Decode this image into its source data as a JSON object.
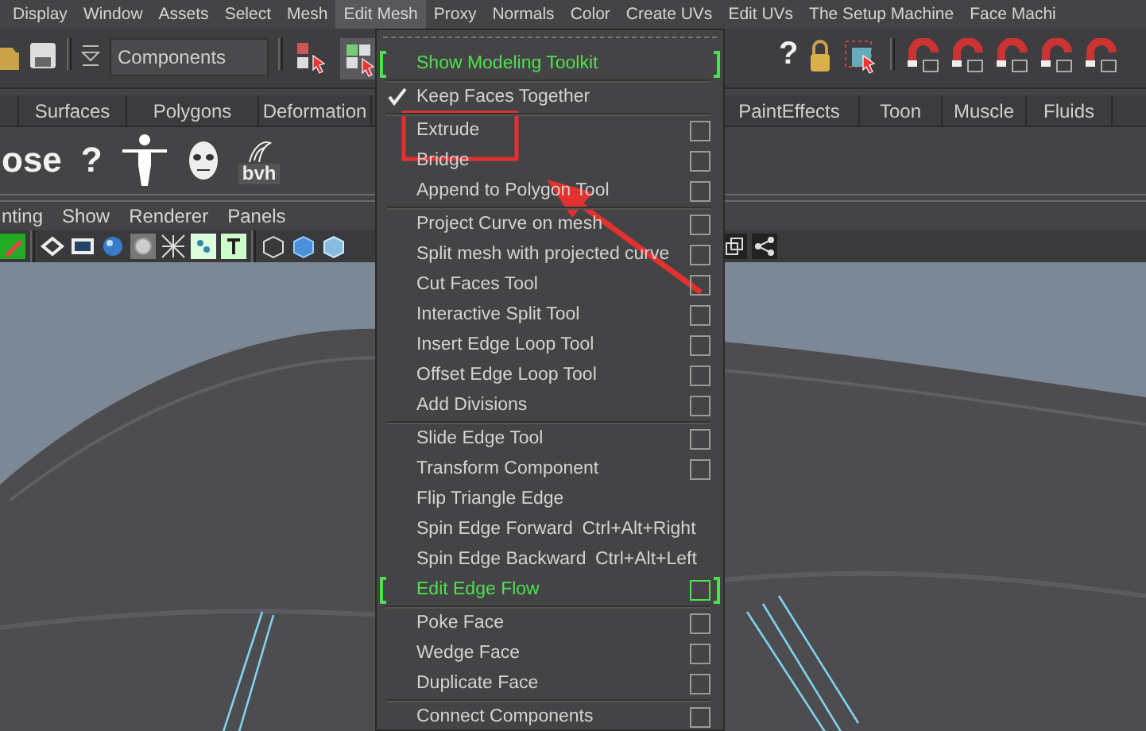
{
  "menubar": [
    {
      "label": "Display",
      "selected": false
    },
    {
      "label": "Window",
      "selected": false
    },
    {
      "label": "Assets",
      "selected": false
    },
    {
      "label": "Select",
      "selected": false
    },
    {
      "label": "Mesh",
      "selected": false
    },
    {
      "label": "Edit Mesh",
      "selected": true
    },
    {
      "label": "Proxy",
      "selected": false
    },
    {
      "label": "Normals",
      "selected": false
    },
    {
      "label": "Color",
      "selected": false
    },
    {
      "label": "Create UVs",
      "selected": false
    },
    {
      "label": "Edit UVs",
      "selected": false
    },
    {
      "label": "The Setup Machine",
      "selected": false
    },
    {
      "label": "Face Machi",
      "selected": false
    }
  ],
  "status_line": {
    "selection_mode": "Components",
    "help": "?"
  },
  "shelf_tabs": [
    "Surfaces",
    "Polygons",
    "Deformation",
    "PaintEffects",
    "Toon",
    "Muscle",
    "Fluids"
  ],
  "shelf": {
    "pose_label": "ose",
    "help": "?",
    "bvh": "bvh"
  },
  "panel_menu": [
    "nting",
    "Show",
    "Renderer",
    "Panels"
  ],
  "dropdown": {
    "items": [
      {
        "kind": "toolkit",
        "label": "Show Modeling Toolkit",
        "option_box": false
      },
      {
        "kind": "separator"
      },
      {
        "kind": "toggle",
        "label": "Keep Faces Together",
        "checked": true
      },
      {
        "kind": "separator"
      },
      {
        "kind": "item",
        "label": "Extrude",
        "option_box": true
      },
      {
        "kind": "item",
        "label": "Bridge",
        "option_box": true
      },
      {
        "kind": "item",
        "label": "Append to Polygon Tool",
        "option_box": true
      },
      {
        "kind": "separator"
      },
      {
        "kind": "item",
        "label": "Project Curve on mesh",
        "option_box": true
      },
      {
        "kind": "item",
        "label": "Split mesh with projected curve",
        "option_box": true
      },
      {
        "kind": "item",
        "label": "Cut Faces Tool",
        "option_box": true
      },
      {
        "kind": "item",
        "label": "Interactive Split Tool",
        "option_box": true
      },
      {
        "kind": "item",
        "label": "Insert Edge Loop Tool",
        "option_box": true
      },
      {
        "kind": "item",
        "label": "Offset Edge Loop Tool",
        "option_box": true
      },
      {
        "kind": "item",
        "label": "Add Divisions",
        "option_box": true
      },
      {
        "kind": "separator"
      },
      {
        "kind": "item",
        "label": "Slide Edge Tool",
        "option_box": true
      },
      {
        "kind": "item",
        "label": "Transform Component",
        "option_box": true
      },
      {
        "kind": "item",
        "label": "Flip Triangle Edge",
        "option_box": false
      },
      {
        "kind": "item",
        "label": "Spin Edge Forward",
        "shortcut": "Ctrl+Alt+Right",
        "option_box": false
      },
      {
        "kind": "item",
        "label": "Spin Edge Backward",
        "shortcut": "Ctrl+Alt+Left",
        "option_box": false
      },
      {
        "kind": "toolkit",
        "label": "Edit Edge Flow",
        "option_box": true
      },
      {
        "kind": "separator"
      },
      {
        "kind": "item",
        "label": "Poke Face",
        "option_box": true
      },
      {
        "kind": "item",
        "label": "Wedge Face",
        "option_box": true
      },
      {
        "kind": "item",
        "label": "Duplicate Face",
        "option_box": true
      },
      {
        "kind": "separator"
      },
      {
        "kind": "item",
        "label": "Connect Components",
        "option_box": true
      }
    ]
  }
}
